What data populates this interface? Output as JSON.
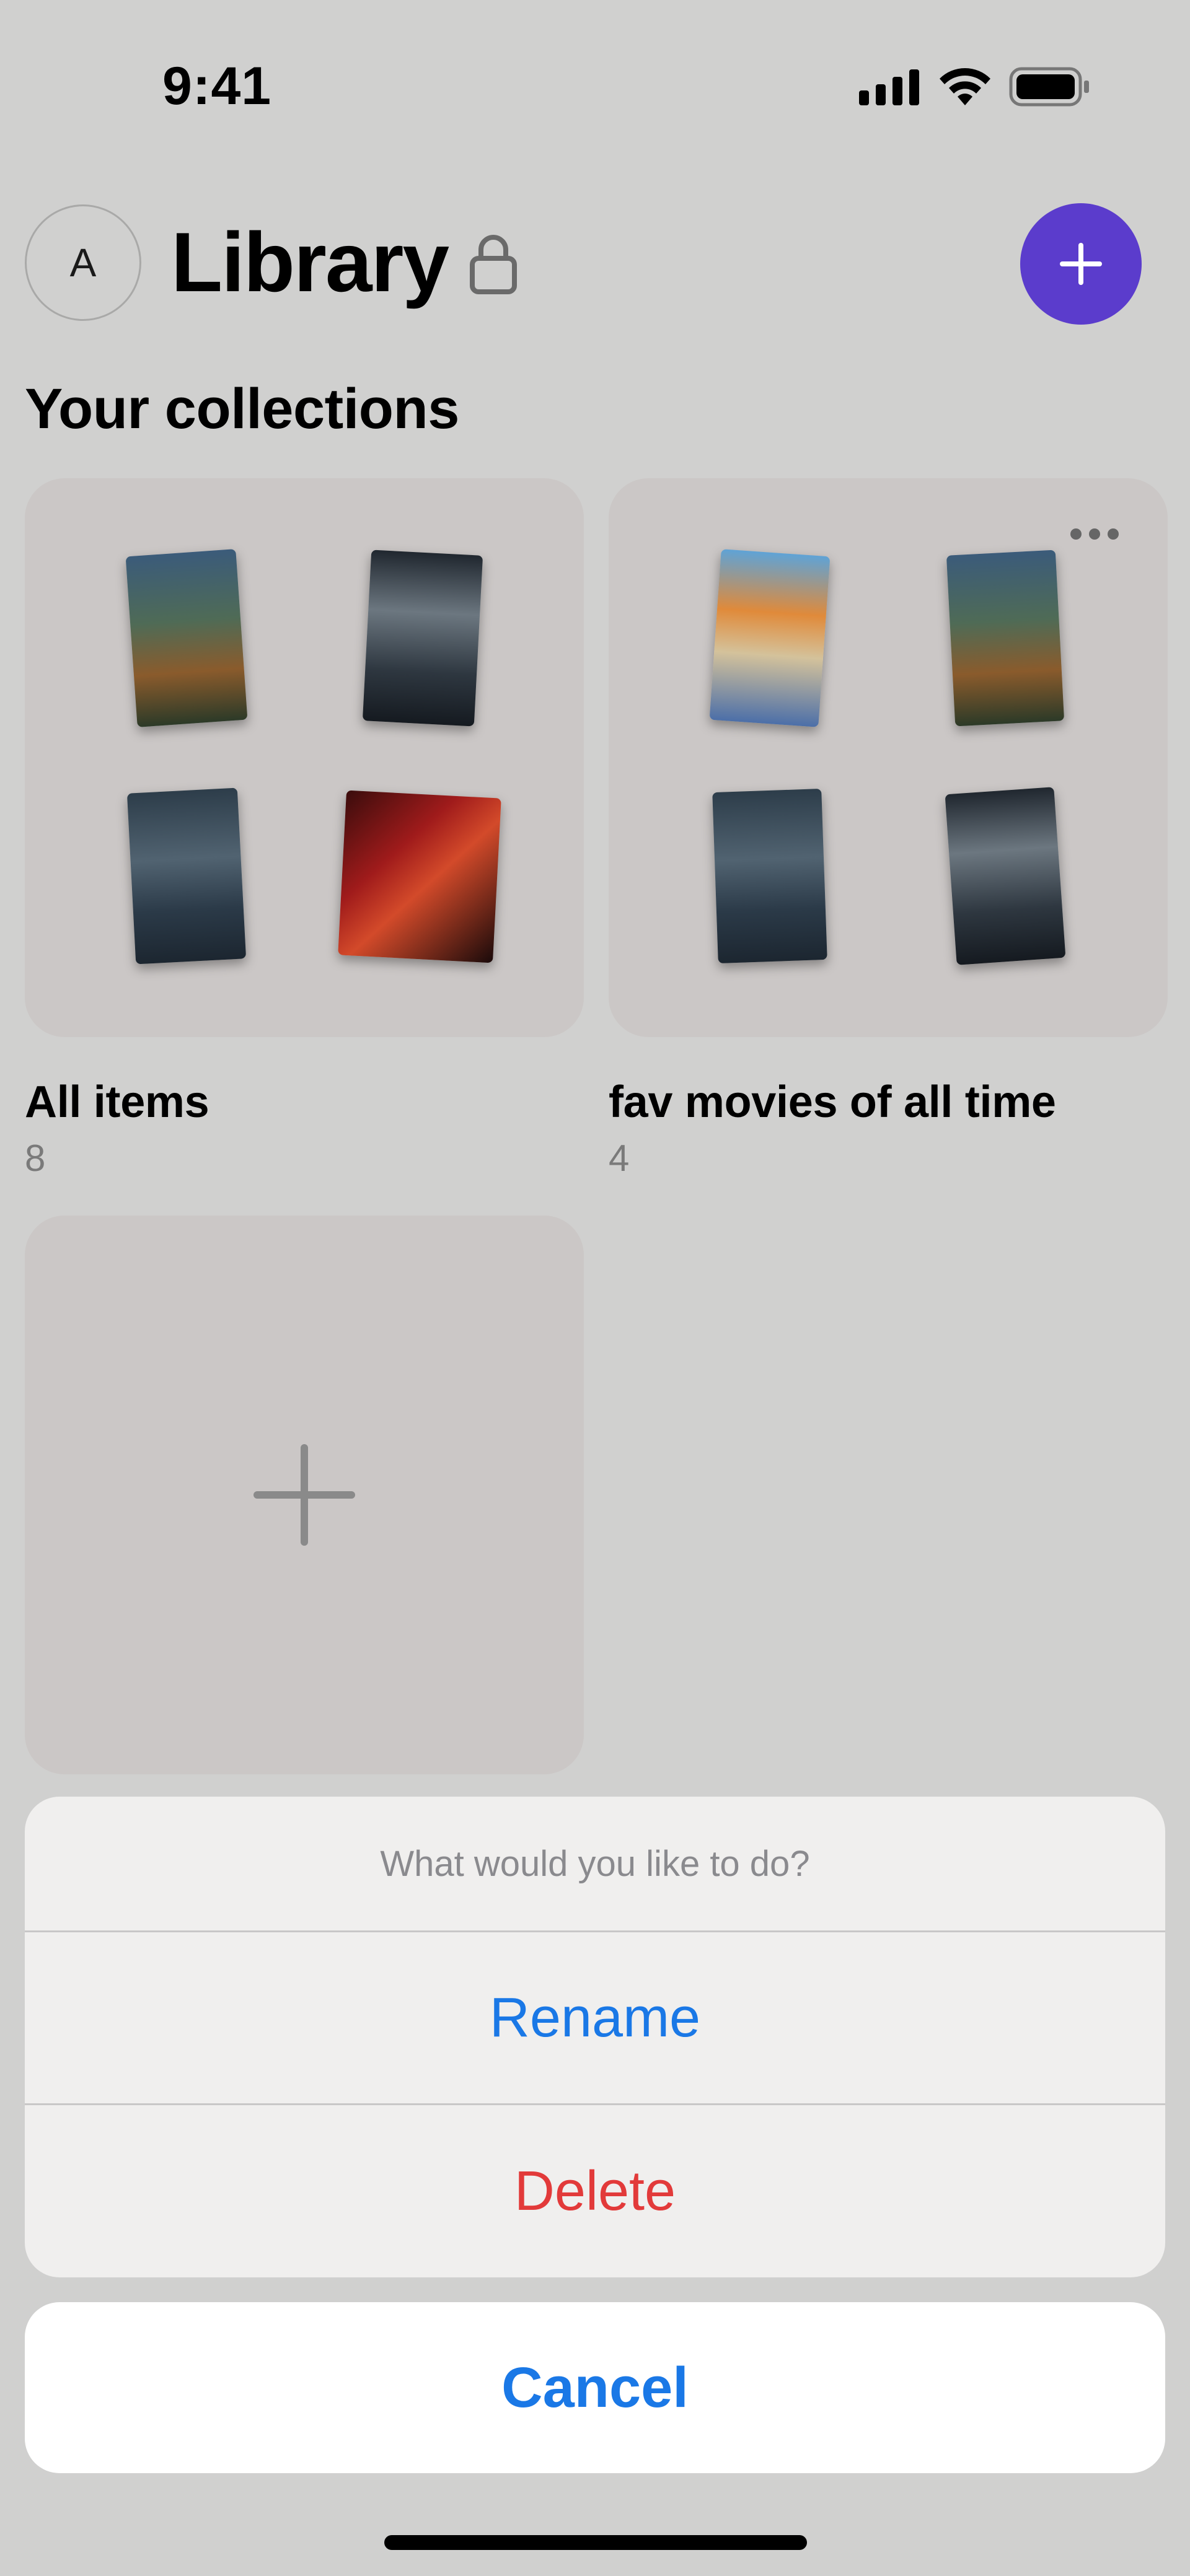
{
  "status_bar": {
    "time": "9:41",
    "icons": [
      "signal-icon",
      "wifi-icon",
      "battery-icon"
    ]
  },
  "header": {
    "avatar_initial": "A",
    "title": "Library",
    "lock_icon": "lock-icon",
    "add_icon": "plus-icon",
    "accent_color": "#5b3ccc"
  },
  "section": {
    "heading": "Your collections"
  },
  "collections": [
    {
      "title": "All items",
      "count": "8",
      "posters": [
        "poster-1",
        "poster-2",
        "poster-3",
        "poster-4"
      ]
    },
    {
      "title": "fav movies of all time",
      "count": "4",
      "more_icon": "more-horizontal-icon",
      "posters": [
        "poster-5",
        "poster-1",
        "poster-3",
        "poster-2"
      ]
    }
  ],
  "new_collection": {
    "icon": "plus-icon"
  },
  "action_sheet": {
    "prompt": "What would you like to do?",
    "rename_label": "Rename",
    "delete_label": "Delete",
    "cancel_label": "Cancel",
    "rename_color": "#1a78e6",
    "delete_color": "#e23a3a"
  }
}
